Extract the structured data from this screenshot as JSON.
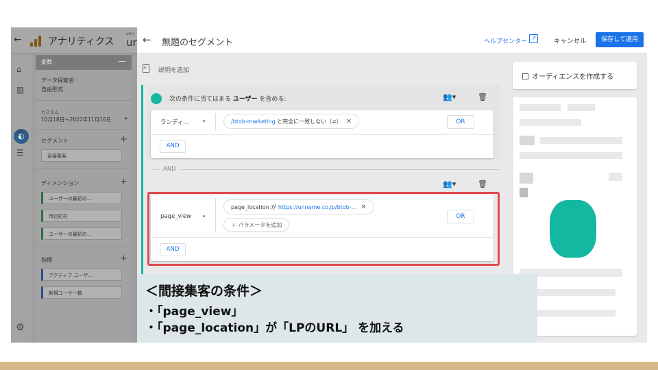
{
  "bg_app": {
    "title": "アナリティクス",
    "account_small": "unn",
    "account_big": "ur",
    "var_header": "変数",
    "exploration_label": "データ探索名:",
    "exploration_value": "自由形式",
    "custom_label": "カスタム",
    "date_range": "10月18日～2022年11月16日",
    "segments_label": "セグメント",
    "segment_item": "直接集客",
    "dimensions_label": "ディメンション",
    "dimension_items": [
      "ユーザーの最初の...",
      "市区町村",
      "ユーザーの最初の..."
    ],
    "metrics_label": "指標",
    "metric_items": [
      "アクティブ ユーザ...",
      "新規ユーザー数"
    ]
  },
  "editor": {
    "title": "無題のセグメント",
    "help_link": "ヘルプセンター",
    "cancel": "キャンセル",
    "save": "保存して適用",
    "add_description": "説明を追加",
    "condition_prefix": "次の条件に当てはまる",
    "condition_scope": "ユーザー",
    "condition_suffix": "を含める:",
    "group1": {
      "dimension": "ランディ...",
      "filter_value": "/btob-marketing",
      "filter_op": "と完全に一致しない（≠）",
      "or": "OR",
      "and": "AND"
    },
    "and_separator": "AND",
    "group2": {
      "dimension": "page_view",
      "param_name": "page_location",
      "param_connector": "が",
      "param_value": "https://unname.co.jp/btob-...",
      "add_param": "パラメータを追加",
      "or": "OR",
      "and": "AND"
    }
  },
  "right_panel": {
    "create_audience": "オーディエンスを作成する"
  },
  "annotation": {
    "title": "＜間接集客の条件＞",
    "line1": "・「page_view」",
    "line2": "・「page_location」が「LPのURL」 を加える"
  },
  "colors": {
    "accent": "#1a73e8",
    "teal": "#14b8a0",
    "highlight_border": "#e0474c",
    "annotation_bg": "#dde6e8"
  }
}
